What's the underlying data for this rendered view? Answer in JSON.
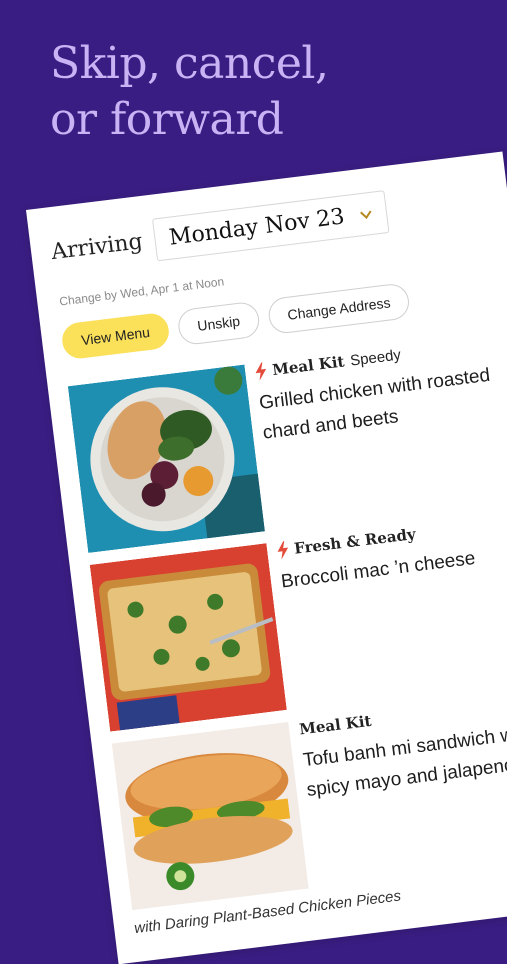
{
  "headline": {
    "line1": "Skip, cancel,",
    "line2": "or forward"
  },
  "delivery": {
    "arriving_label": "Arriving",
    "date": "Monday Nov 23",
    "change_by": "Change by Wed, Apr 1 at Noon"
  },
  "actions": {
    "view_menu": "View Menu",
    "unskip": "Unskip",
    "change_address": "Change Address"
  },
  "meals": [
    {
      "brand": "Meal Kit",
      "sub": "Speedy",
      "title": "Grilled chicken with roasted chard and beets",
      "bolt": true
    },
    {
      "brand": "Fresh & Ready",
      "sub": "",
      "title": "Broccoli mac ’n cheese",
      "bolt": true
    },
    {
      "brand": "Meal Kit",
      "sub": "",
      "title": "Tofu banh mi sandwich with spicy mayo and jalapenos",
      "bolt": false
    }
  ],
  "meal3_caption": "with Daring Plant-Based Chicken Pieces",
  "colors": {
    "background": "#3a1d82",
    "headline": "#c9b3f5",
    "accent_button": "#fbe05a",
    "bolt": "#e34b3a"
  }
}
